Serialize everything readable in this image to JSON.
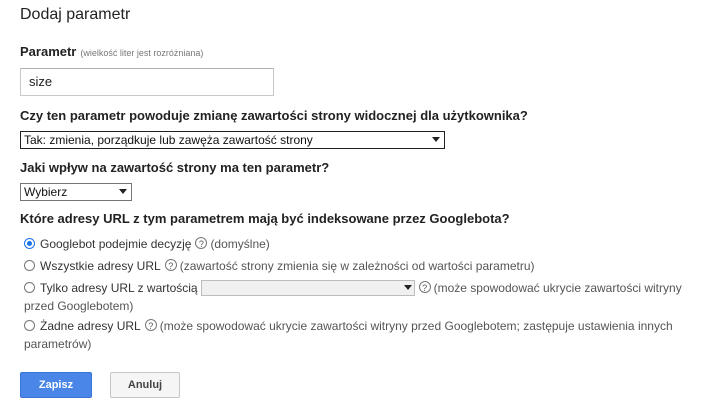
{
  "dialog": {
    "title": "Dodaj parametr"
  },
  "parameter": {
    "label": "Parametr",
    "hint": "(wielkość liter jest rozróżniana)",
    "value": "size"
  },
  "q_changes": {
    "question": "Czy ten parametr powoduje zmianę zawartości strony widocznej dla użytkownika?",
    "selected": "Tak: zmienia, porządkuje lub zawęża zawartość strony"
  },
  "q_effect": {
    "question": "Jaki wpływ na zawartość strony ma ten parametr?",
    "selected": "Wybierz"
  },
  "q_index": {
    "question": "Które adresy URL z tym parametrem mają być indeksowane przez Googlebota?",
    "options": [
      {
        "label": "Googlebot podejmie decyzję",
        "note": "(domyślne)",
        "checked": true
      },
      {
        "label": "Wszystkie adresy URL",
        "note": "(zawartość strony zmienia się w zależności od wartości parametru)",
        "checked": false
      },
      {
        "label": "Tylko adresy URL z wartością",
        "note": "(może spowodować ukrycie zawartości witryny przed Googlebotem)",
        "checked": false
      },
      {
        "label": "Żadne adresy URL",
        "note": "(może spowodować ukrycie zawartości witryny przed Googlebotem; zastępuje ustawienia innych parametrów)",
        "checked": false
      }
    ],
    "help_icon": "question-circle-icon"
  },
  "buttons": {
    "save": "Zapisz",
    "cancel": "Anuluj"
  },
  "colors": {
    "primary": "#4a86e8",
    "radio_checked": "#1a73e8"
  }
}
